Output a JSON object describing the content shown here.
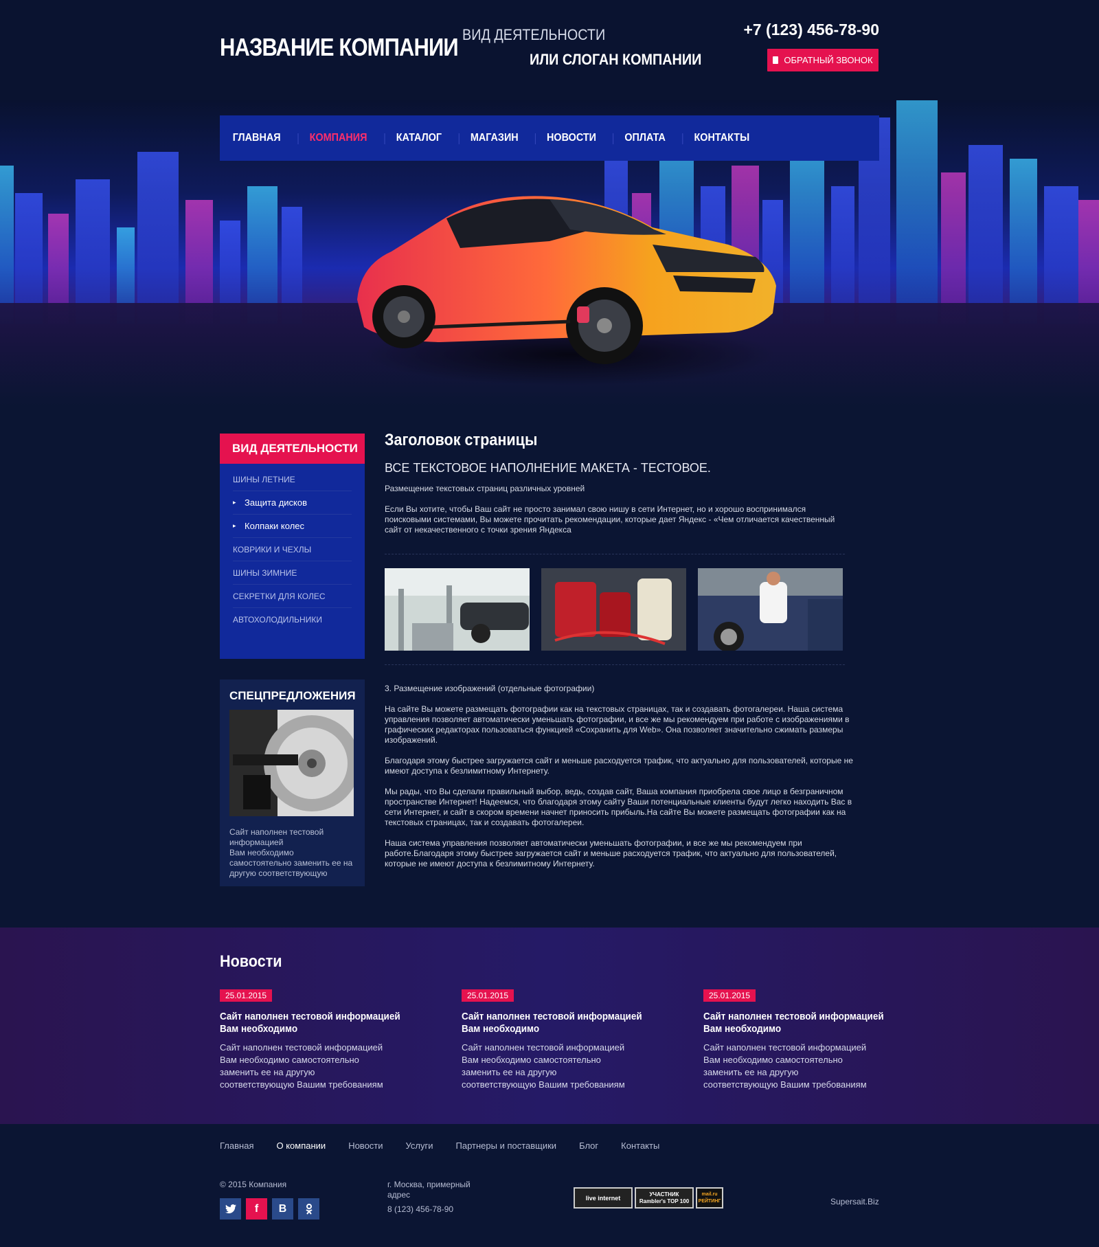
{
  "header": {
    "logo": "НАЗВАНИЕ КОМПАНИИ",
    "tagline1": "ВИД ДЕЯТЕЛЬНОСТИ",
    "tagline2": "ИЛИ СЛОГАН КОМПАНИИ",
    "phone": "+7 (123) 456-78-90",
    "callback_label": "ОБРАТНЫЙ ЗВОНОК"
  },
  "nav": {
    "items": [
      "ГЛАВНАЯ",
      "КОМПАНИЯ",
      "КАТАЛОГ",
      "МАГАЗИН",
      "НОВОСТИ",
      "ОПЛАТА",
      "КОНТАКТЫ"
    ],
    "active": "КОМПАНИЯ"
  },
  "sidebar": {
    "title": "ВИД ДЕЯТЕЛЬНОСТИ",
    "items": [
      "ШИНЫ ЛЕТНИЕ",
      "Защита дисков",
      "Колпаки колес",
      "КОВРИКИ И ЧЕХЛЫ",
      "ШИНЫ ЗИМНИЕ",
      "СЕКРЕТКИ ДЛЯ КОЛЕС",
      "АВТОХОЛОДИЛЬНИКИ"
    ],
    "offers_title": "СПЕЦПРЕДЛОЖЕНИЯ",
    "offers_text_1": "Сайт наполнен тестовой информацией",
    "offers_text_2": "Вам необходимо самостоятельно заменить ее на другую соответствующую"
  },
  "content": {
    "title": "Заголовок страницы",
    "subtitle": "ВСЕ ТЕКСТОВОЕ НАПОЛНЕНИЕ МАКЕТА - ТЕСТОВОЕ.",
    "intro": "Размещение текстовых страниц различных уровней",
    "p1": "Если Вы хотите, чтобы Ваш сайт не просто занимал свою нишу в сети Интернет, но и хорошо воспринимался поисковыми системами, Вы можете прочитать рекомендации, которые дает Яндекс - «Чем отличается качественный сайт от некачественного с точки зрения Яндекса",
    "section": "3. Размещение изображений (отдельные фотографии)",
    "p2": "На сайте Вы можете размещать фотографии как на текстовых страницах, так и создавать фотогалереи. Наша система управления позволяет автоматически уменьшать фотографии, и все же мы рекомендуем при работе с изображениями в графических редакторах пользоваться функцией «Сохранить для Web». Она позволяет значительно сжимать размеры изображений.",
    "p3": "Благодаря этому быстрее загружается сайт и меньше расходуется трафик, что актуально для пользователей, которые не имеют доступа к безлимитному Интернету.",
    "p4": "Мы рады, что Вы сделали правильный выбор, ведь, создав сайт, Ваша компания приобрела свое лицо в безграничном пространстве Интернет! Надеемся, что благодаря этому сайту Ваши потенциальные клиенты будут легко находить Вас в сети Интернет, и сайт в скором времени начнет приносить прибыль.На сайте Вы можете размещать фотографии как на текстовых страницах, так и создавать фотогалереи.",
    "p5": "Наша система управления позволяет автоматически уменьшать фотографии, и все же мы рекомендуем при работе.Благодаря этому быстрее загружается сайт и меньше расходуется трафик, что актуально для пользователей, которые не имеют доступа к безлимитному Интернету."
  },
  "news": {
    "title": "Новости",
    "items": [
      {
        "date": "25.01.2015",
        "head": "Сайт наполнен тестовой информацией Вам необходимо",
        "text": "Сайт наполнен тестовой информацией Вам необходимо самостоятельно заменить ее на другую соответствующую Вашим требованиям"
      },
      {
        "date": "25.01.2015",
        "head": "Сайт наполнен тестовой информацией Вам необходимо",
        "text": "Сайт наполнен тестовой информацией Вам необходимо самостоятельно заменить ее на другую соответствующую Вашим требованиям"
      },
      {
        "date": "25.01.2015",
        "head": "Сайт наполнен тестовой информацией Вам необходимо",
        "text": "Сайт наполнен тестовой информацией Вам необходимо самостоятельно заменить ее на другую соответствующую Вашим требованиям"
      }
    ]
  },
  "footer": {
    "nav": [
      "Главная",
      "О компании",
      "Новости",
      "Услуги",
      "Партнеры и поставщики",
      "Блог",
      "Контакты"
    ],
    "nav_active": "О компании",
    "copyright": "© 2015 Компания",
    "address": "г. Москва, примерный адрес",
    "phone": "8 (123) 456-78-90",
    "counter1": "live internet",
    "counter2": "УЧАСТНИК Rambler's TOP 100",
    "counter3": "mail.ru РЕЙТИНГ",
    "brand": "Supersait.Biz",
    "social": [
      "twitter-icon",
      "facebook-icon",
      "vk-icon",
      "odnoklassniki-icon"
    ]
  },
  "colors": {
    "accent": "#e5124f",
    "nav_bg": "#11299b",
    "page_bg": "#0b1533"
  }
}
